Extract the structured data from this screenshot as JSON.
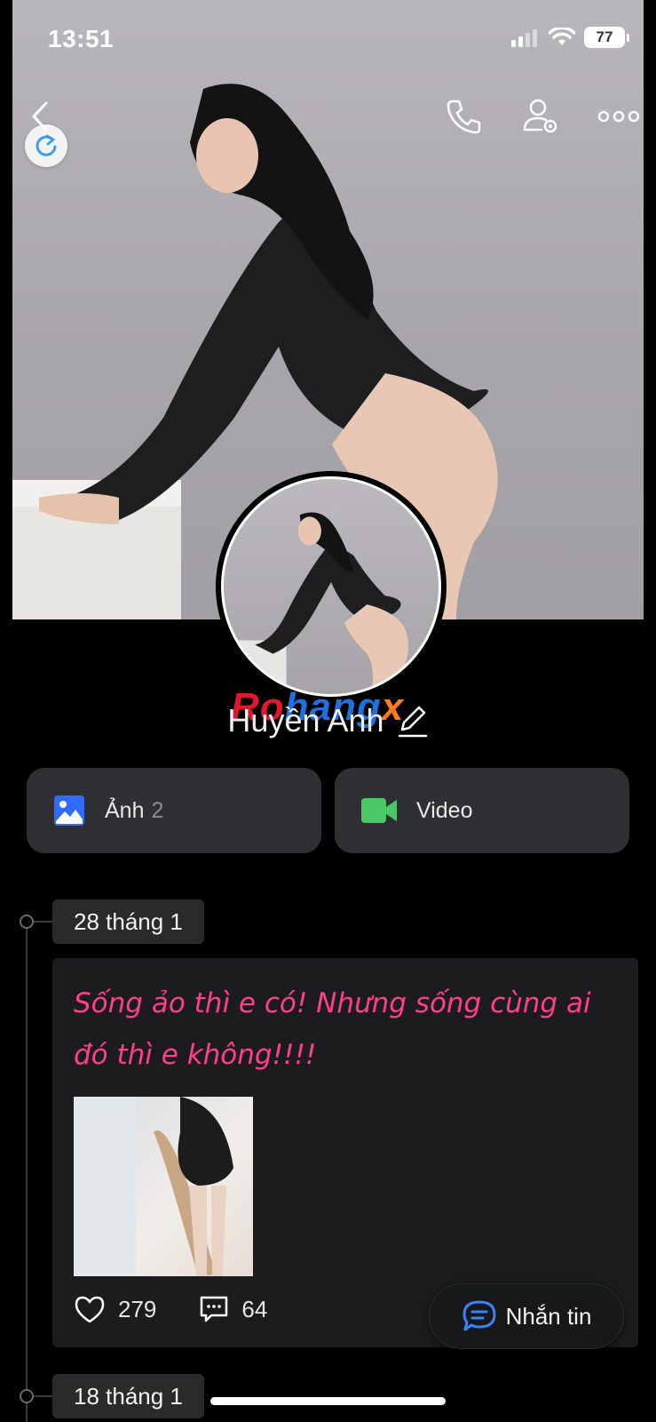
{
  "status_bar": {
    "time": "13:51",
    "battery": "77"
  },
  "icons": {
    "back": "chevron-left-icon",
    "refresh": "refresh-icon",
    "call": "phone-icon",
    "settings": "user-settings-icon",
    "more": "more-icon",
    "edit": "pencil-icon",
    "photos": "image-icon",
    "video": "video-camera-icon",
    "like": "heart-icon",
    "comment": "comment-icon",
    "message": "chat-bubble-icon"
  },
  "profile": {
    "name": "Huyền Anh",
    "watermark_parts": [
      "Ro",
      "hang",
      "x"
    ]
  },
  "media": {
    "photos_label": "Ảnh",
    "photos_count": "2",
    "video_label": "Video"
  },
  "timeline": [
    {
      "date": "28 tháng 1",
      "text": "Sống ảo thì e có! Nhưng sống cùng ai đó thì e không!!!!",
      "likes": "279",
      "comments": "64"
    },
    {
      "date": "18 tháng 1"
    }
  ],
  "message_button": {
    "label": "Nhắn tin"
  },
  "colors": {
    "background": "#000000",
    "card": "#1c1c1e",
    "button": "#2f3033",
    "post_text": "#ff3f8a",
    "photo_icon": "#2f6bff",
    "video_icon": "#4cc765",
    "message_icon": "#3b82f6"
  }
}
